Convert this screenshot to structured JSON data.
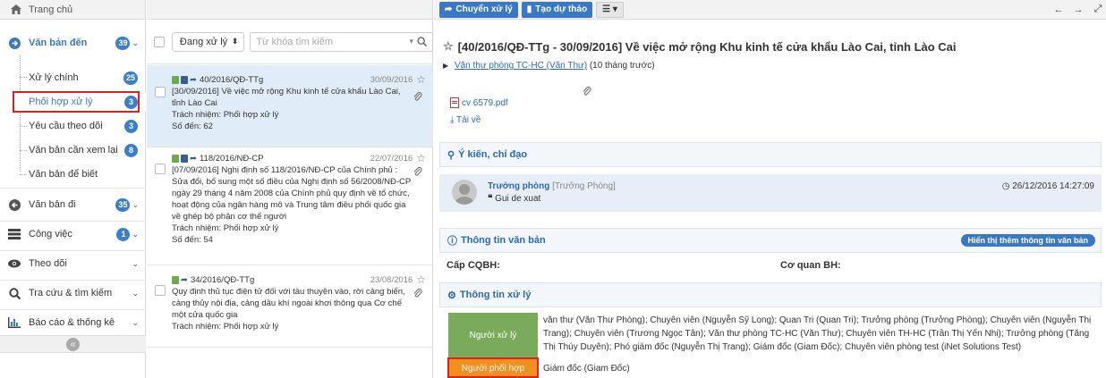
{
  "sidebar": {
    "home": "Trang chủ",
    "incoming": {
      "label": "Văn bản đến",
      "count": "39"
    },
    "sub_items": [
      {
        "label": "Xử lý chính",
        "count": "25"
      },
      {
        "label": "Phối hợp xử lý",
        "count": "3"
      },
      {
        "label": "Yêu cầu theo dõi",
        "count": "3"
      },
      {
        "label": "Văn bản cần xem lại",
        "count": "8"
      },
      {
        "label": "Văn bản để biết",
        "count": ""
      }
    ],
    "outgoing": {
      "label": "Văn bản đi",
      "count": "35"
    },
    "tasks": {
      "label": "Công việc",
      "count": "1"
    },
    "tracking": {
      "label": "Theo dõi"
    },
    "search": {
      "label": "Tra cứu & tìm kiếm"
    },
    "reports": {
      "label": "Báo cáo & thống kê"
    },
    "collapse": "«"
  },
  "list": {
    "status_select": "Đang xử lý",
    "search_placeholder": "Từ khóa tìm kiếm",
    "items": [
      {
        "number": "40/2016/QĐ-TTg",
        "date": "30/09/2016",
        "summary_1": "[30/09/2016] Về việc mở rộng Khu kinh tế cửa khẩu Lào Cai,",
        "summary_2": "tỉnh Lào Cai",
        "responsibility": "Trách nhiệm: Phối hợp xử lý",
        "incoming_no": "Số đến: 62"
      },
      {
        "number": "118/2016/NĐ-CP",
        "date": "22/07/2016",
        "summary_1": "[07/09/2016] Nghị định số 118/2016/NĐ-CP của Chính phủ :",
        "summary_2": "Sửa đổi, bổ sung một số điều của Nghị định số 56/2008/NĐ-CP",
        "summary_3": "ngày 29 tháng 4 năm 2008 của Chính phủ quy định về tổ chức,",
        "summary_4": "hoạt động của ngân hàng mô và Trung tâm điều phối quốc gia",
        "summary_5": "về ghép bộ phận cơ thể người",
        "responsibility": "Trách nhiệm: Phối hợp xử lý",
        "incoming_no": "Số đến: 54"
      },
      {
        "number": "34/2016/QĐ-TTg",
        "date": "23/08/2016",
        "summary_1": "Quy định thủ tục điện tử đối với tàu thuyền vào, rời cảng biển,",
        "summary_2": "cảng thủy nội địa, cảng dầu khí ngoài khơi thông qua Cơ chế",
        "summary_3": "một cửa quốc gia",
        "responsibility": "Trách nhiệm: Phối hợp xử lý"
      }
    ]
  },
  "detail": {
    "toolbar": {
      "forward": "Chuyển xử lý",
      "draft": "Tạo dự thảo"
    },
    "title": "[40/2016/QĐ-TTg - 30/09/2016] Về việc mở rộng Khu kinh tế cửa khẩu Lào Cai, tỉnh Lào Cai",
    "sender_link": "Văn thư phòng TC-HC (Văn Thư)",
    "sender_suffix": "(10 tháng trước)",
    "attachment": "cv 6579.pdf",
    "download": "Tải về",
    "opinion_header": "Ý kiến, chỉ đạo",
    "opinion_author": "Trưởng phòng",
    "opinion_role": "[Trưởng Phòng]",
    "opinion_text": "Gui de xuat",
    "opinion_time": "26/12/2016 14:27:09",
    "info_header": "Thông tin văn bản",
    "info_more": "Hiển thị thêm thông tin văn bản",
    "issuer_label": "Cấp CQBH:",
    "agency_label": "Cơ quan BH:",
    "process_header": "Thông tin xử lý",
    "processor_label": "Người xử lý",
    "processor_line1": "văn thư (Văn Thư Phòng); Chuyên viên (Nguyễn Sỹ Long); Quan Tri (Quan Tri); Trưởng phòng (Trưởng Phòng); Chuyên viên (Nguyễn Thị",
    "processor_line2": "Trang); Chuyên viên (Trương Ngọc Tân); Văn thư phòng TC-HC (Văn Thư); Chuyên viên TH-HC (Trần Thị Yến Nhi); Trưởng phòng (Tăng",
    "processor_line3": "Thị Thúy Duyên); Phó giám đốc (Nguyễn Thị Trang); Giám đốc (Giam Đốc); Chuyên viên phòng test (iNet Solutions Test)",
    "coordinator_label": "Người phối hợp",
    "coordinator_value": "Giám đốc (Giam Đốc)"
  },
  "colors": {
    "accent": "#3a78c3",
    "green_cell": "#7aab5a",
    "orange_cell": "#f0901e",
    "highlight": "#e02020"
  }
}
